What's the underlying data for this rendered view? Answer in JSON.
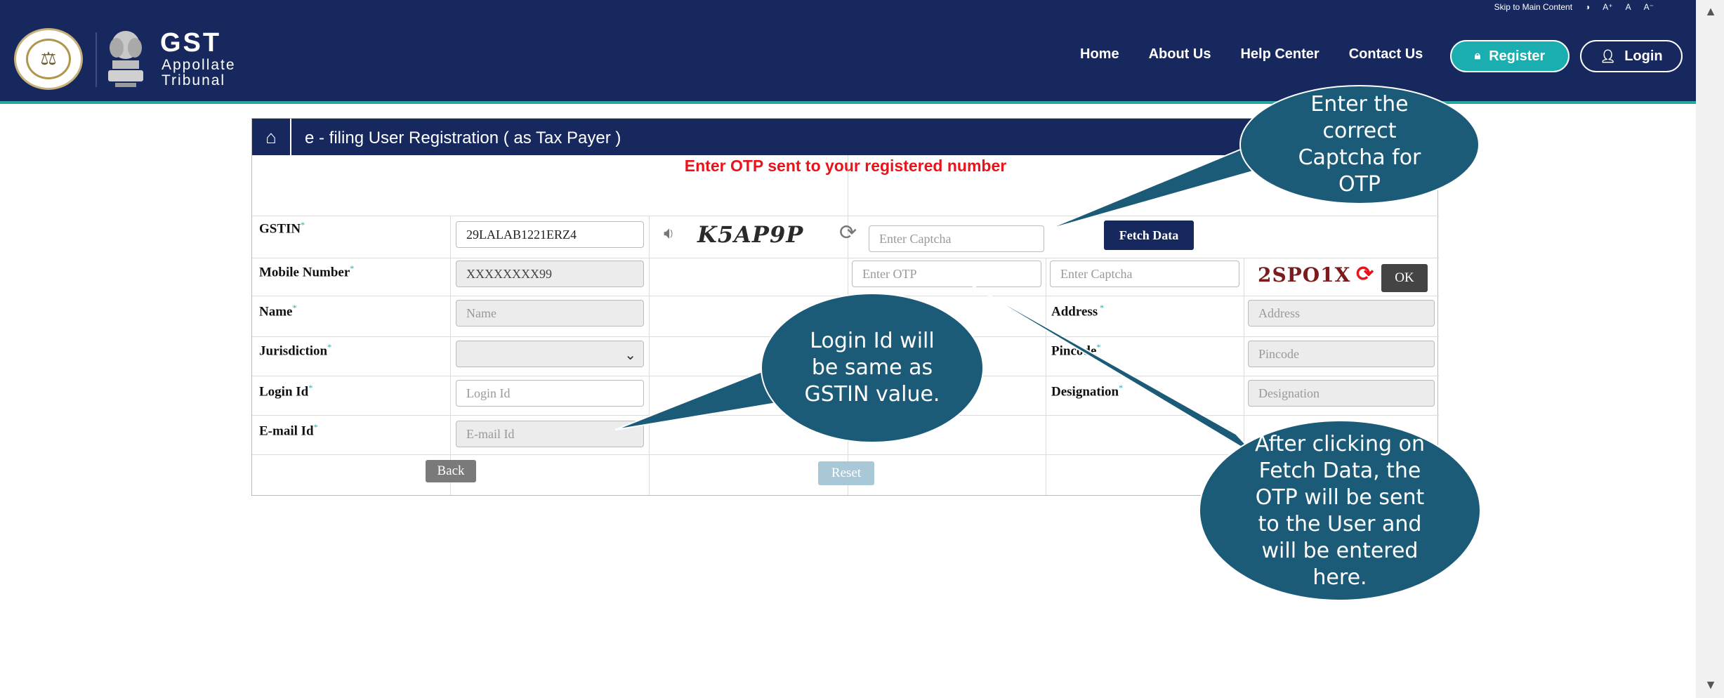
{
  "a11y": {
    "skip": "Skip to Main Content",
    "contrast": "◑",
    "font_up": "A⁺",
    "font_normal": "A",
    "font_down": "A⁻"
  },
  "brand": {
    "title": "GST",
    "line1": "Appollate",
    "line2": "Tribunal"
  },
  "nav": {
    "home": "Home",
    "about": "About Us",
    "help": "Help Center",
    "contact": "Contact Us",
    "register": "Register",
    "login": "Login"
  },
  "panel": {
    "title": "e - filing User Registration ( as Tax Payer )",
    "otp_message": "Enter OTP sent to your registered number"
  },
  "form": {
    "gstin_label": "GSTIN",
    "gstin_value": "29LALAB1221ERZ4",
    "captcha1_text": "K5AP9P",
    "captcha1_placeholder": "Enter Captcha",
    "fetch_label": "Fetch Data",
    "mobile_label": "Mobile Number",
    "mobile_value": "XXXXXXXX99",
    "otp_placeholder": "Enter OTP",
    "captcha2_placeholder": "Enter Captcha",
    "captcha2_text": "2SPO1X",
    "ok_label": "OK",
    "name_label": "Name",
    "name_placeholder": "Name",
    "address_label": "Address",
    "address_placeholder": "Address",
    "jurisdiction_label": "Jurisdiction",
    "pincode_label": "Pincode",
    "pincode_placeholder": "Pincode",
    "loginid_label": "Login Id",
    "loginid_placeholder": "Login Id",
    "designation_label": "Designation",
    "designation_placeholder": "Designation",
    "email_label": "E-mail Id",
    "email_placeholder": "E-mail Id",
    "back_label": "Back",
    "reset_label": "Reset"
  },
  "callouts": {
    "captcha": "Enter the correct Captcha for OTP",
    "login": "Login Id will be same as GSTIN value.",
    "otp": "After clicking on Fetch Data, the OTP will be sent to the User and will be entered here."
  },
  "colors": {
    "navy": "#16285e",
    "teal": "#1aaeb0",
    "callout": "#1b5b78",
    "otp_red": "#e8141c"
  }
}
